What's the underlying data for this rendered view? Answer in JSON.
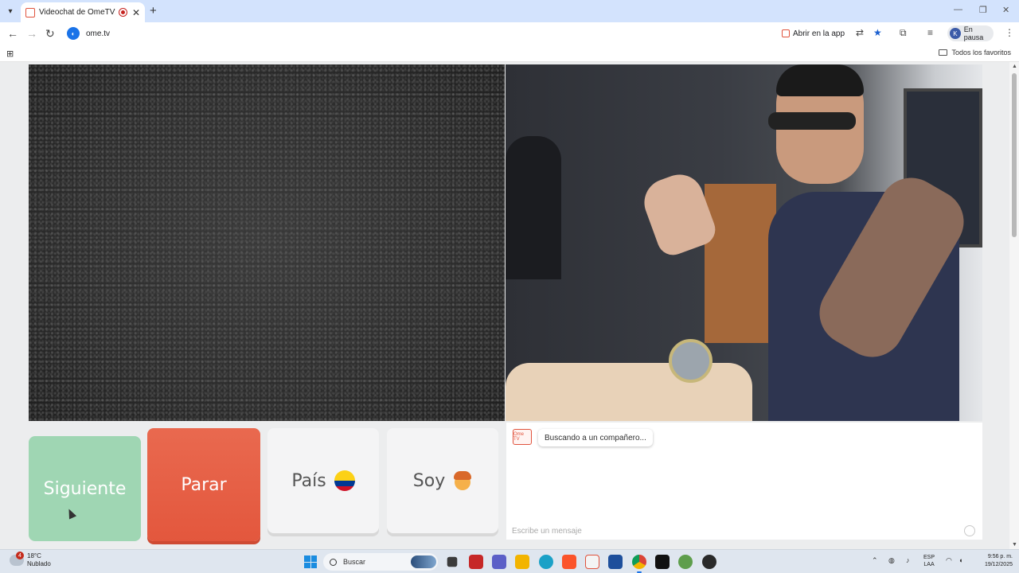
{
  "browser": {
    "tab_title": "Videochat de OmeTV: alternativa a Chatroulette",
    "tab_close": "✕",
    "new_tab": "+",
    "url": "ome.tv",
    "open_in_app": "Abrir en la app",
    "profile_initial": "K",
    "profile_status": "En pausa",
    "all_favorites": "Todos los favoritos"
  },
  "buttons": {
    "next": "Siguiente",
    "stop": "Parar",
    "country": "País",
    "i_am": "Soy"
  },
  "chat": {
    "logo_text": "Ome TV",
    "status_message": "Buscando a un compañero...",
    "input_placeholder": "Escribe un mensaje"
  },
  "taskbar": {
    "weather_temp": "18°C",
    "weather_desc": "Nublado",
    "weather_badge": "4",
    "search_label": "Buscar",
    "lang_top": "ESP",
    "lang_bottom": "LAA",
    "time": "9:56 p. m.",
    "date": "19/12/2025"
  },
  "colors": {
    "next_button": "#9fd6b3",
    "stop_button": "#e3573d",
    "neutral_button": "#f4f4f5",
    "accent_brand": "#e0533d"
  },
  "icons": {
    "flag": "colombia-flag-icon",
    "gender": "boy-emoji-icon"
  }
}
